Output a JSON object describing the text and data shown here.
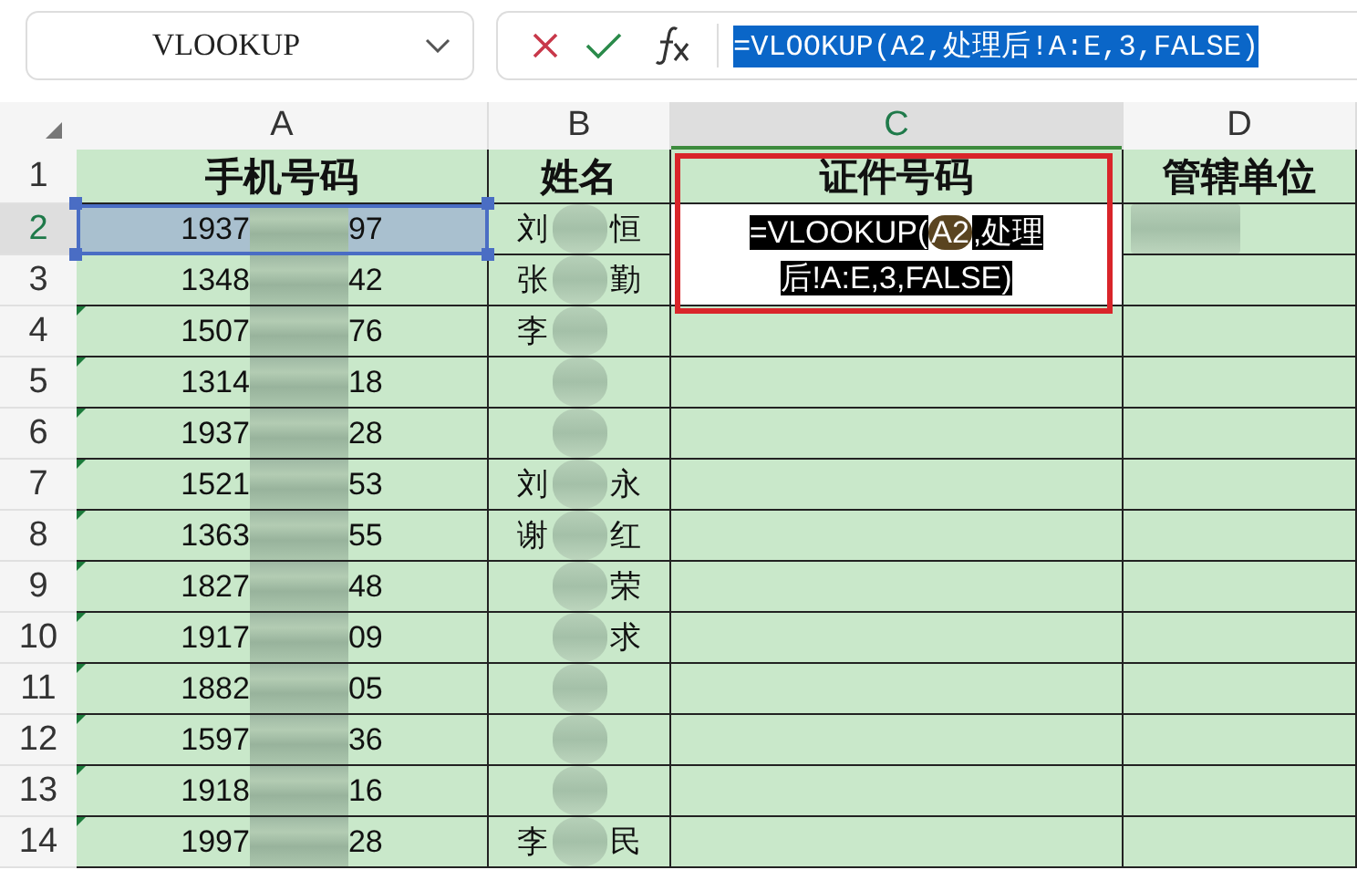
{
  "name_box": {
    "value": "VLOOKUP"
  },
  "formula_bar": {
    "formula": "=VLOOKUP(A2,处理后!A:E,3,FALSE)",
    "selected": true
  },
  "columns": [
    {
      "label": "A",
      "selected": false
    },
    {
      "label": "B",
      "selected": false
    },
    {
      "label": "C",
      "selected": true
    },
    {
      "label": "D",
      "selected": false
    }
  ],
  "rows": [
    {
      "number": "1",
      "kind": "header",
      "selected": false,
      "cells": [
        "手机号码",
        "姓名",
        "证件号码",
        "管辖单位"
      ]
    },
    {
      "number": "2",
      "kind": "data",
      "selected": true,
      "flagged": false,
      "phone": {
        "start": "1937",
        "end": "97",
        "selected": true
      },
      "name": {
        "start": "刘",
        "end": "恒"
      }
    },
    {
      "number": "3",
      "kind": "data",
      "selected": false,
      "flagged": false,
      "phone": {
        "start": "1348",
        "end": "42",
        "selected": false
      },
      "name": {
        "start": "张",
        "end": "勤"
      }
    },
    {
      "number": "4",
      "kind": "data",
      "selected": false,
      "flagged": true,
      "phone": {
        "start": "1507",
        "end": "76",
        "selected": false
      },
      "name": {
        "start": "李"
      }
    },
    {
      "number": "5",
      "kind": "data",
      "selected": false,
      "flagged": true,
      "phone": {
        "start": "1314",
        "end": "18",
        "selected": false
      },
      "name": {}
    },
    {
      "number": "6",
      "kind": "data",
      "selected": false,
      "flagged": true,
      "phone": {
        "start": "1937",
        "end": "28",
        "selected": false
      },
      "name": {}
    },
    {
      "number": "7",
      "kind": "data",
      "selected": false,
      "flagged": true,
      "phone": {
        "start": "1521",
        "end": "53",
        "selected": false
      },
      "name": {
        "start": "刘",
        "end": "永"
      }
    },
    {
      "number": "8",
      "kind": "data",
      "selected": false,
      "flagged": true,
      "phone": {
        "start": "1363",
        "end": "55",
        "selected": false
      },
      "name": {
        "start": "谢",
        "end": "红"
      }
    },
    {
      "number": "9",
      "kind": "data",
      "selected": false,
      "flagged": true,
      "phone": {
        "start": "1827",
        "end": "48",
        "selected": false
      },
      "name": {
        "end": "荣"
      }
    },
    {
      "number": "10",
      "kind": "data",
      "selected": false,
      "flagged": true,
      "phone": {
        "start": "1917",
        "end": "09",
        "selected": false
      },
      "name": {
        "end": "求"
      }
    },
    {
      "number": "11",
      "kind": "data",
      "selected": false,
      "flagged": true,
      "phone": {
        "start": "1882",
        "end": "05",
        "selected": false
      },
      "name": {}
    },
    {
      "number": "12",
      "kind": "data",
      "selected": false,
      "flagged": true,
      "phone": {
        "start": "1597",
        "end": "36",
        "selected": false
      },
      "name": {}
    },
    {
      "number": "13",
      "kind": "data",
      "selected": false,
      "flagged": true,
      "phone": {
        "start": "1918",
        "end": "16",
        "selected": false
      },
      "name": {}
    },
    {
      "number": "14",
      "kind": "data",
      "selected": false,
      "flagged": true,
      "phone": {
        "start": "1997",
        "end": "28",
        "selected": false
      },
      "name": {
        "start": "李",
        "end": "民"
      }
    }
  ],
  "editor": {
    "lines": [
      [
        {
          "kind": "text",
          "text": "=VLOOKUP("
        },
        {
          "kind": "ref",
          "text": "A2"
        },
        {
          "kind": "text",
          "text": ",处理"
        }
      ],
      [
        {
          "kind": "text",
          "text": "后!A:E,3,FALSE)"
        }
      ]
    ]
  }
}
